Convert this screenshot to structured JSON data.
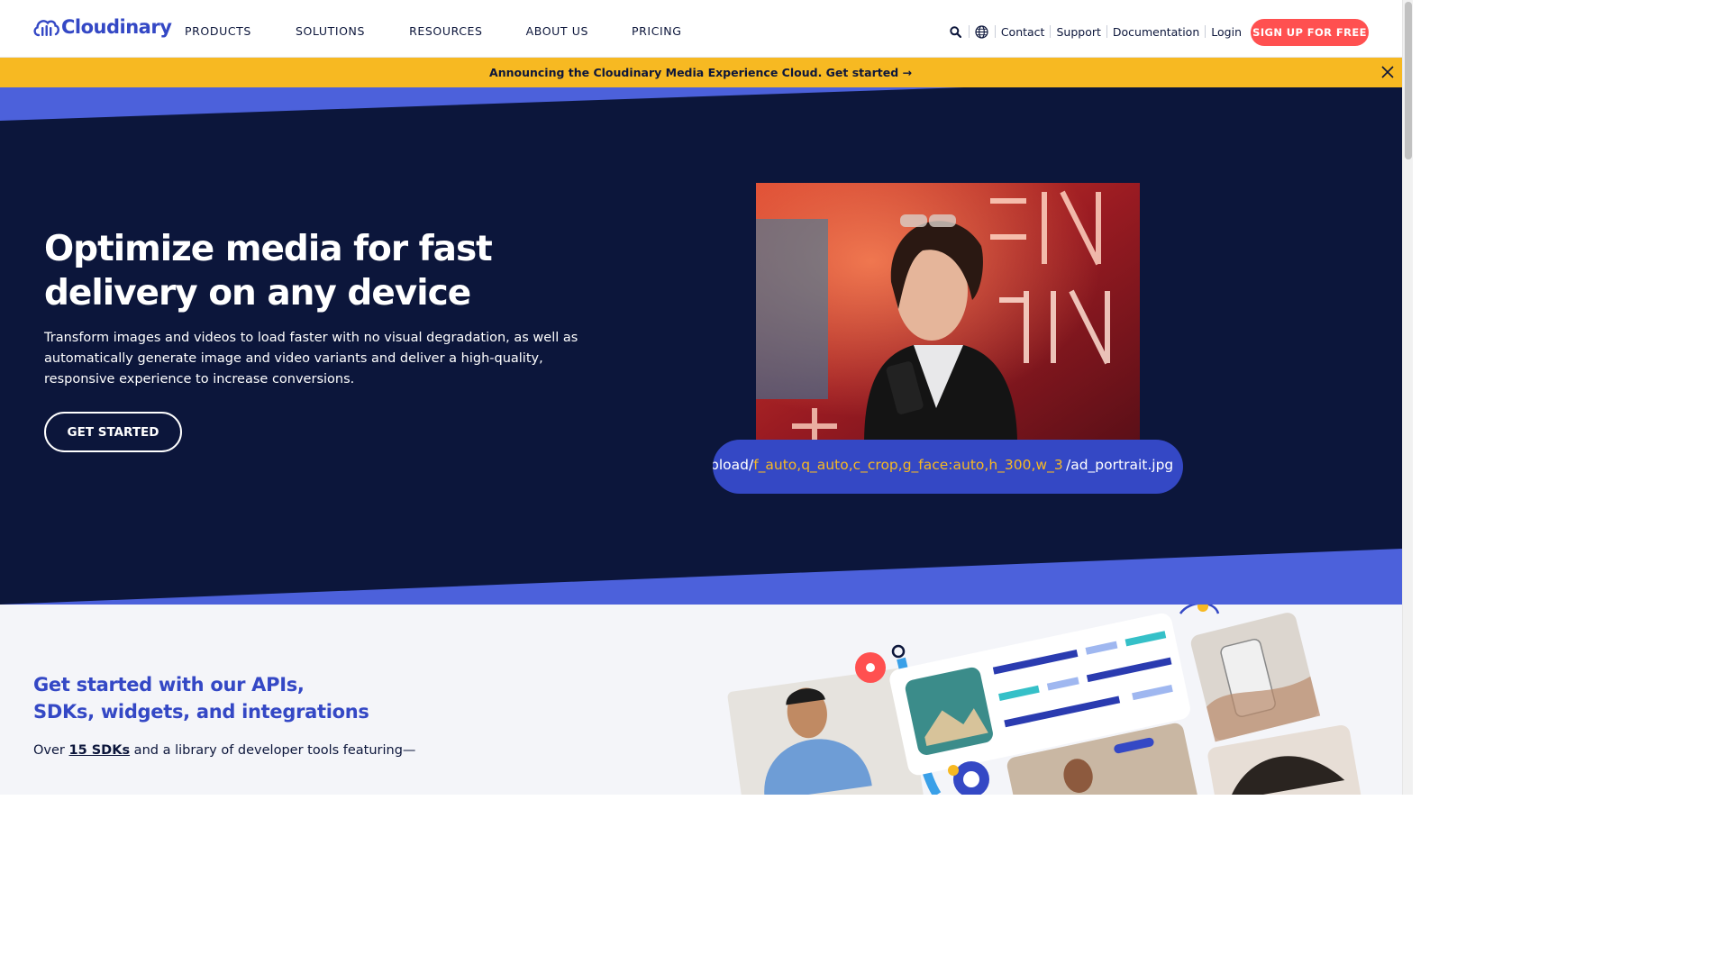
{
  "header": {
    "logo_text": "Cloudinary",
    "nav": [
      "PRODUCTS",
      "SOLUTIONS",
      "RESOURCES",
      "ABOUT US",
      "PRICING"
    ],
    "utility": {
      "contact": "Contact",
      "support": "Support",
      "documentation": "Documentation",
      "login": "Login"
    },
    "signup_label": "SIGN UP FOR FREE"
  },
  "announcement": {
    "text": "Announcing the Cloudinary Media Experience Cloud. Get started →"
  },
  "hero": {
    "title_line1": "Optimize media for fast",
    "title_line2": "delivery on any device",
    "description": "Transform images and videos to load faster with no visual degradation, as well as automatically generate image and video variants and deliver a high-quality, responsive experience to increase conversions.",
    "cta_label": "GET STARTED",
    "url_prefix": "pload/",
    "url_transform": "f_auto,q_auto,c_crop,g_face:auto,h_300,w_3",
    "url_suffix": "/ad_portrait.jpg"
  },
  "section2": {
    "title_line1": "Get started with our APIs,",
    "title_line2": "SDKs, widgets, and integrations",
    "desc_before": "Over ",
    "desc_link": "15 SDKs",
    "desc_after": " and a library of developer tools featuring—"
  },
  "colors": {
    "navy": "#0c163b",
    "brand_blue": "#3448c5",
    "coral": "#ff5050",
    "yellow": "#f7b922",
    "periwinkle": "#4c61db"
  },
  "icons": [
    "search-icon",
    "globe-icon",
    "close-icon"
  ]
}
